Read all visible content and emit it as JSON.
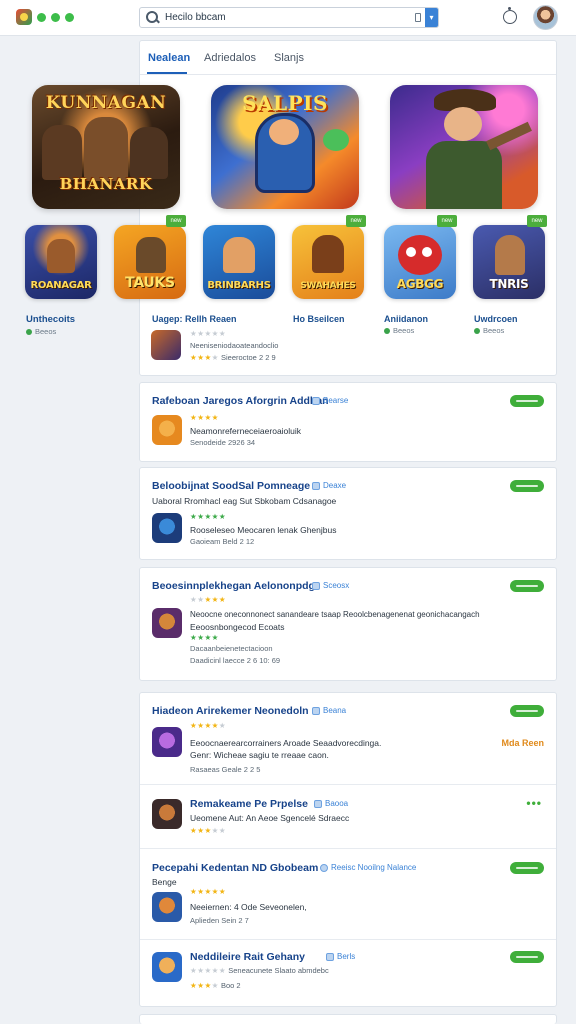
{
  "header": {
    "search_value": "Hecilo bbcam",
    "search_placeholder": "Search"
  },
  "tabs": [
    {
      "label": "Nealean",
      "active": true
    },
    {
      "label": "Adriedalos",
      "active": false
    },
    {
      "label": "Slanjs",
      "active": false
    }
  ],
  "hero": [
    {
      "title_top": "KUNNAGAN",
      "title_bottom": "BHANARK"
    },
    {
      "title_top": "SALPIS",
      "title_bottom": ""
    },
    {
      "title_top": "",
      "title_bottom": ""
    }
  ],
  "tiles": [
    {
      "label": "ROANAGAR",
      "name": "Unthecoits",
      "sub": "Beeos",
      "badge": ""
    },
    {
      "label": "TAUKS",
      "name": "Uagep: Rellh Reaen",
      "sub": "",
      "badge": "new"
    },
    {
      "label": "BRINBARHS",
      "name": "",
      "sub": "",
      "badge": ""
    },
    {
      "label": "SWAHAHES",
      "name": "Ho Bseilcen",
      "sub": "",
      "badge": "new"
    },
    {
      "label": "AGBGG",
      "name": "Aniidanon",
      "sub": "Beeos",
      "badge": "new"
    },
    {
      "label": "TNRIS",
      "name": "Uwdrcoen",
      "sub": "Beeos",
      "badge": "new"
    }
  ],
  "main_rows": {
    "row1": "Neeniseniodaoateandoclio",
    "row2": "Sieeroctoe 2   2  9"
  },
  "cards": [
    {
      "title": "Rafeboan Jaregos Aforgrin Addhan",
      "tag": "Bearse",
      "lines": [
        "Neamonreferneceiaeroaioluik",
        "Senodeide 2926 34"
      ]
    },
    {
      "title": "Beloobijnat SoodSal Pomneage",
      "tag": "Deaxe",
      "lines": [
        "Uaboral Rromhacl eag Sut Sbkobam Cdsanagoe",
        "Rooseleseo Meocaren lenak Ghenjbus",
        "Gaoieam Beld 2   12"
      ]
    },
    {
      "title": "Beoesinnplekhegan Aelononpdg",
      "tag": "Sceosx",
      "lines": [
        "Neoocne oneconnonect sanandeare tsaap Reoolcbenagenenat geonichacangach",
        "Eeoosnbongecod Ecoats",
        "Dacaanbeienetectacioon",
        "Daadicinl laecce 2   6   10: 69"
      ]
    },
    {
      "title": "Hiadeon Arirekemer Neonedoln",
      "tag": "Beana",
      "lines": [
        "Eeoocnaerearcorrainers Aroade Seaadvorecdinga.",
        "Genr: Wicheae sagiu te rreaae caon.",
        "Rasaeas Geale 2   2   5"
      ],
      "orange": "Mda Reen"
    },
    {
      "title": "Remakeame Pe Prpelse",
      "tag": "Baooa",
      "lines": [
        "Ueomene Aut: An Aeoe Sgencelé Sdraecc",
        ""
      ]
    },
    {
      "title": "Pecepahi Kedentan ND Gbobeam",
      "tag": "Reeisc Nooilng Nalance",
      "lines": [
        "Benge",
        "Neeiernen: 4 Ode Seveonelen,",
        "Aplieden Sein 2   7"
      ]
    },
    {
      "title": "Neddileire Rait Gehany",
      "tag": "Berls",
      "lines": [
        "Seneacunete Slaato abmdebc",
        "Boo 2"
      ]
    }
  ],
  "left_column": {
    "title": "Unthecoits",
    "sub": "Beeos"
  },
  "colors": {
    "accent": "#1d5fb8",
    "green": "#3fae3a",
    "star": "#f2b515",
    "orange": "#e08a1b"
  }
}
